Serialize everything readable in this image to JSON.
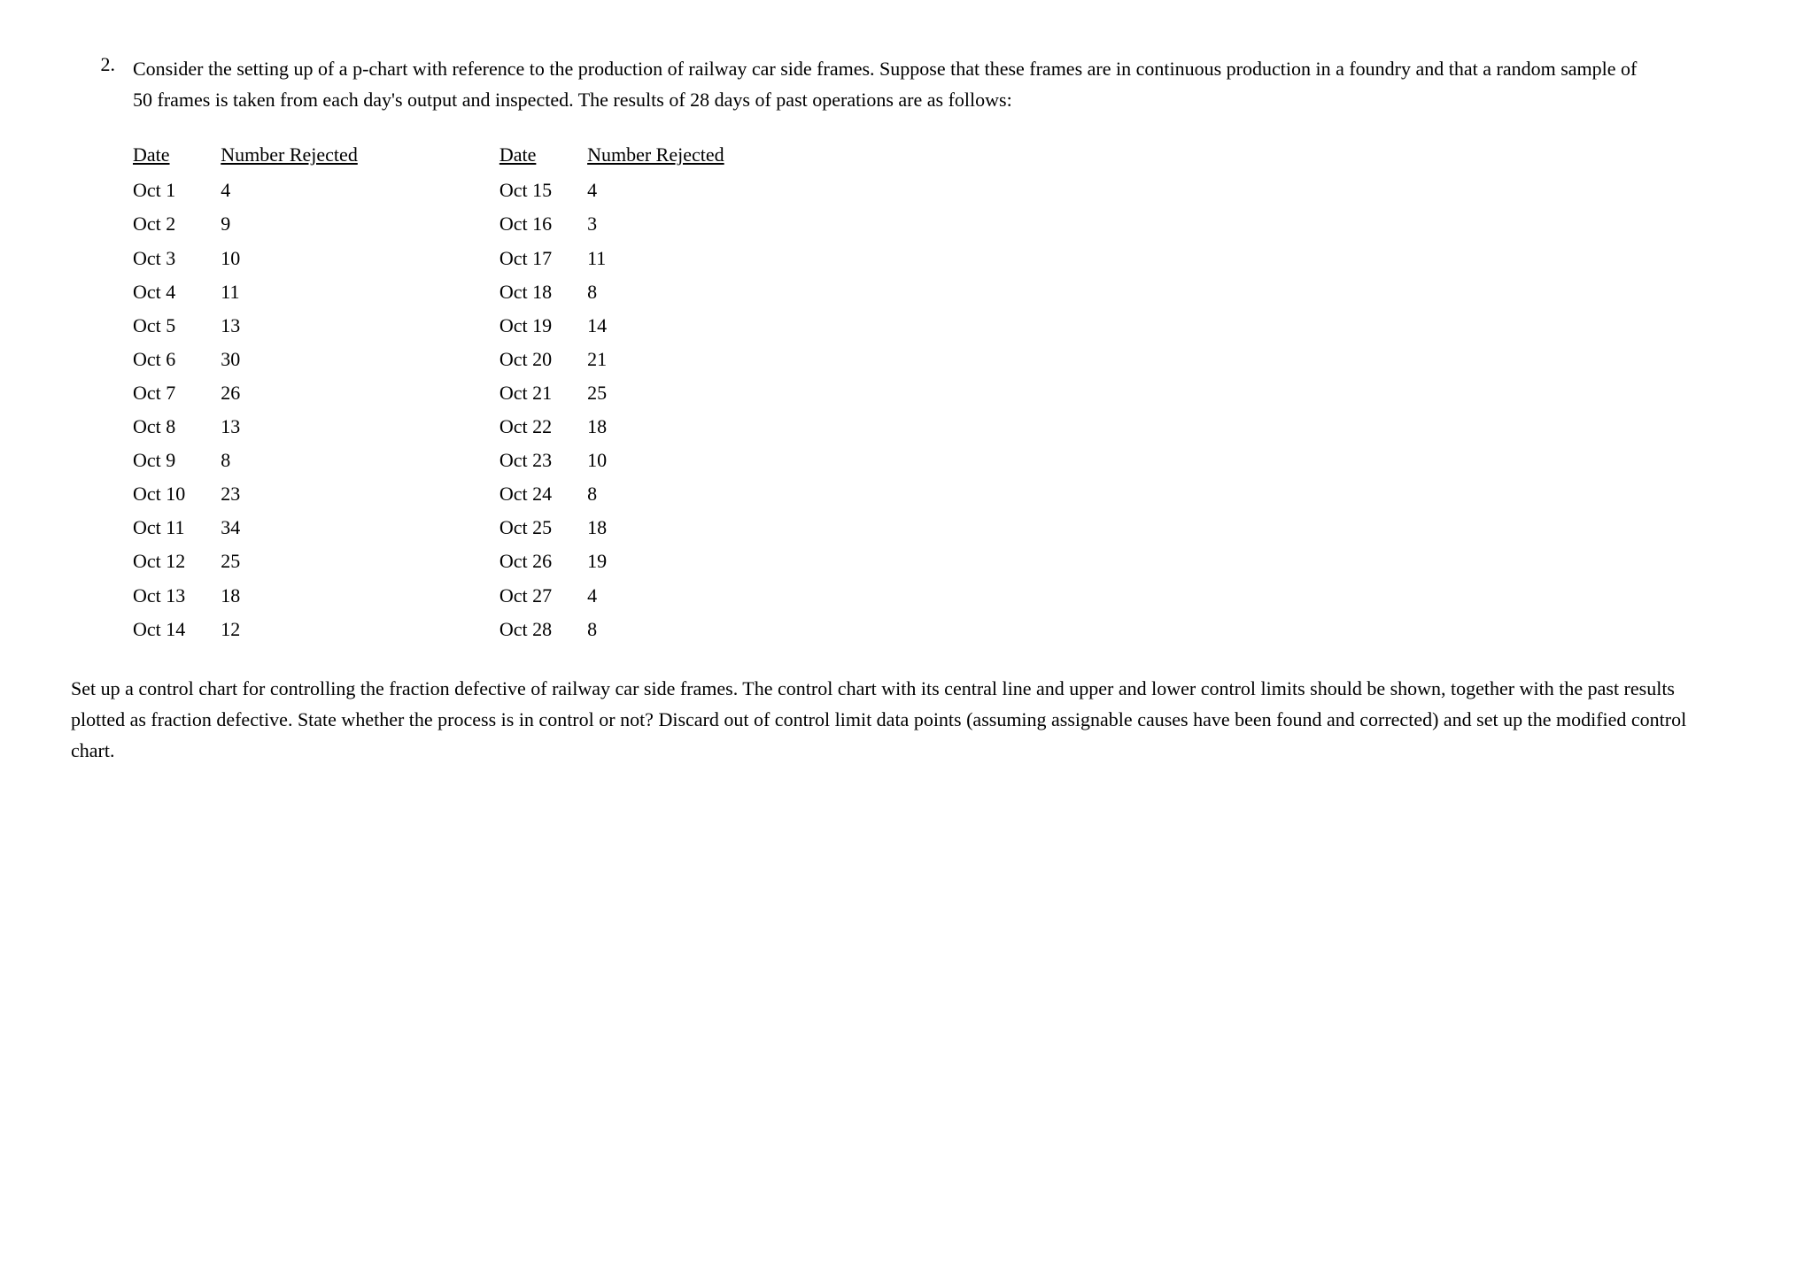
{
  "question": {
    "number": "2.",
    "intro": "Consider the setting up of a p-chart with reference to the production of railway car side frames. Suppose that these frames are in continuous production in a foundry and that a random sample of 50 frames is taken from each day's output and inspected. The results of 28 days of past operations are as follows:",
    "table": {
      "col1_header_date": "Date",
      "col1_header_rejected": "Number Rejected",
      "col2_header_date": "Date",
      "col2_header_rejected": "Number Rejected",
      "left_rows": [
        {
          "date": "Oct 1",
          "rejected": "4"
        },
        {
          "date": "Oct 2",
          "rejected": "9"
        },
        {
          "date": "Oct 3",
          "rejected": "10"
        },
        {
          "date": "Oct 4",
          "rejected": "11"
        },
        {
          "date": "Oct 5",
          "rejected": "13"
        },
        {
          "date": "Oct 6",
          "rejected": "30"
        },
        {
          "date": "Oct 7",
          "rejected": "26"
        },
        {
          "date": "Oct 8",
          "rejected": "13"
        },
        {
          "date": "Oct 9",
          "rejected": "8"
        },
        {
          "date": "Oct 10",
          "rejected": "23"
        },
        {
          "date": "Oct 11",
          "rejected": "34"
        },
        {
          "date": "Oct 12",
          "rejected": "25"
        },
        {
          "date": "Oct 13",
          "rejected": "18"
        },
        {
          "date": "Oct 14",
          "rejected": "12"
        }
      ],
      "right_rows": [
        {
          "date": "Oct 15",
          "rejected": "4"
        },
        {
          "date": "Oct 16",
          "rejected": "3"
        },
        {
          "date": "Oct 17",
          "rejected": "11"
        },
        {
          "date": "Oct 18",
          "rejected": "8"
        },
        {
          "date": "Oct 19",
          "rejected": "14"
        },
        {
          "date": "Oct 20",
          "rejected": "21"
        },
        {
          "date": "Oct 21",
          "rejected": "25"
        },
        {
          "date": "Oct 22",
          "rejected": "18"
        },
        {
          "date": "Oct 23",
          "rejected": "10"
        },
        {
          "date": "Oct 24",
          "rejected": "8"
        },
        {
          "date": "Oct 25",
          "rejected": "18"
        },
        {
          "date": "Oct 26",
          "rejected": "19"
        },
        {
          "date": "Oct 27",
          "rejected": "4"
        },
        {
          "date": "Oct 28",
          "rejected": "8"
        }
      ]
    },
    "closing": "Set up a control chart for controlling the fraction defective of railway car side frames. The control chart with its central line and upper and lower control limits should be shown, together with the past results plotted as fraction defective. State whether the process is in control or not? Discard out of control limit data points (assuming assignable causes have been found and corrected) and set up the modified control chart."
  }
}
